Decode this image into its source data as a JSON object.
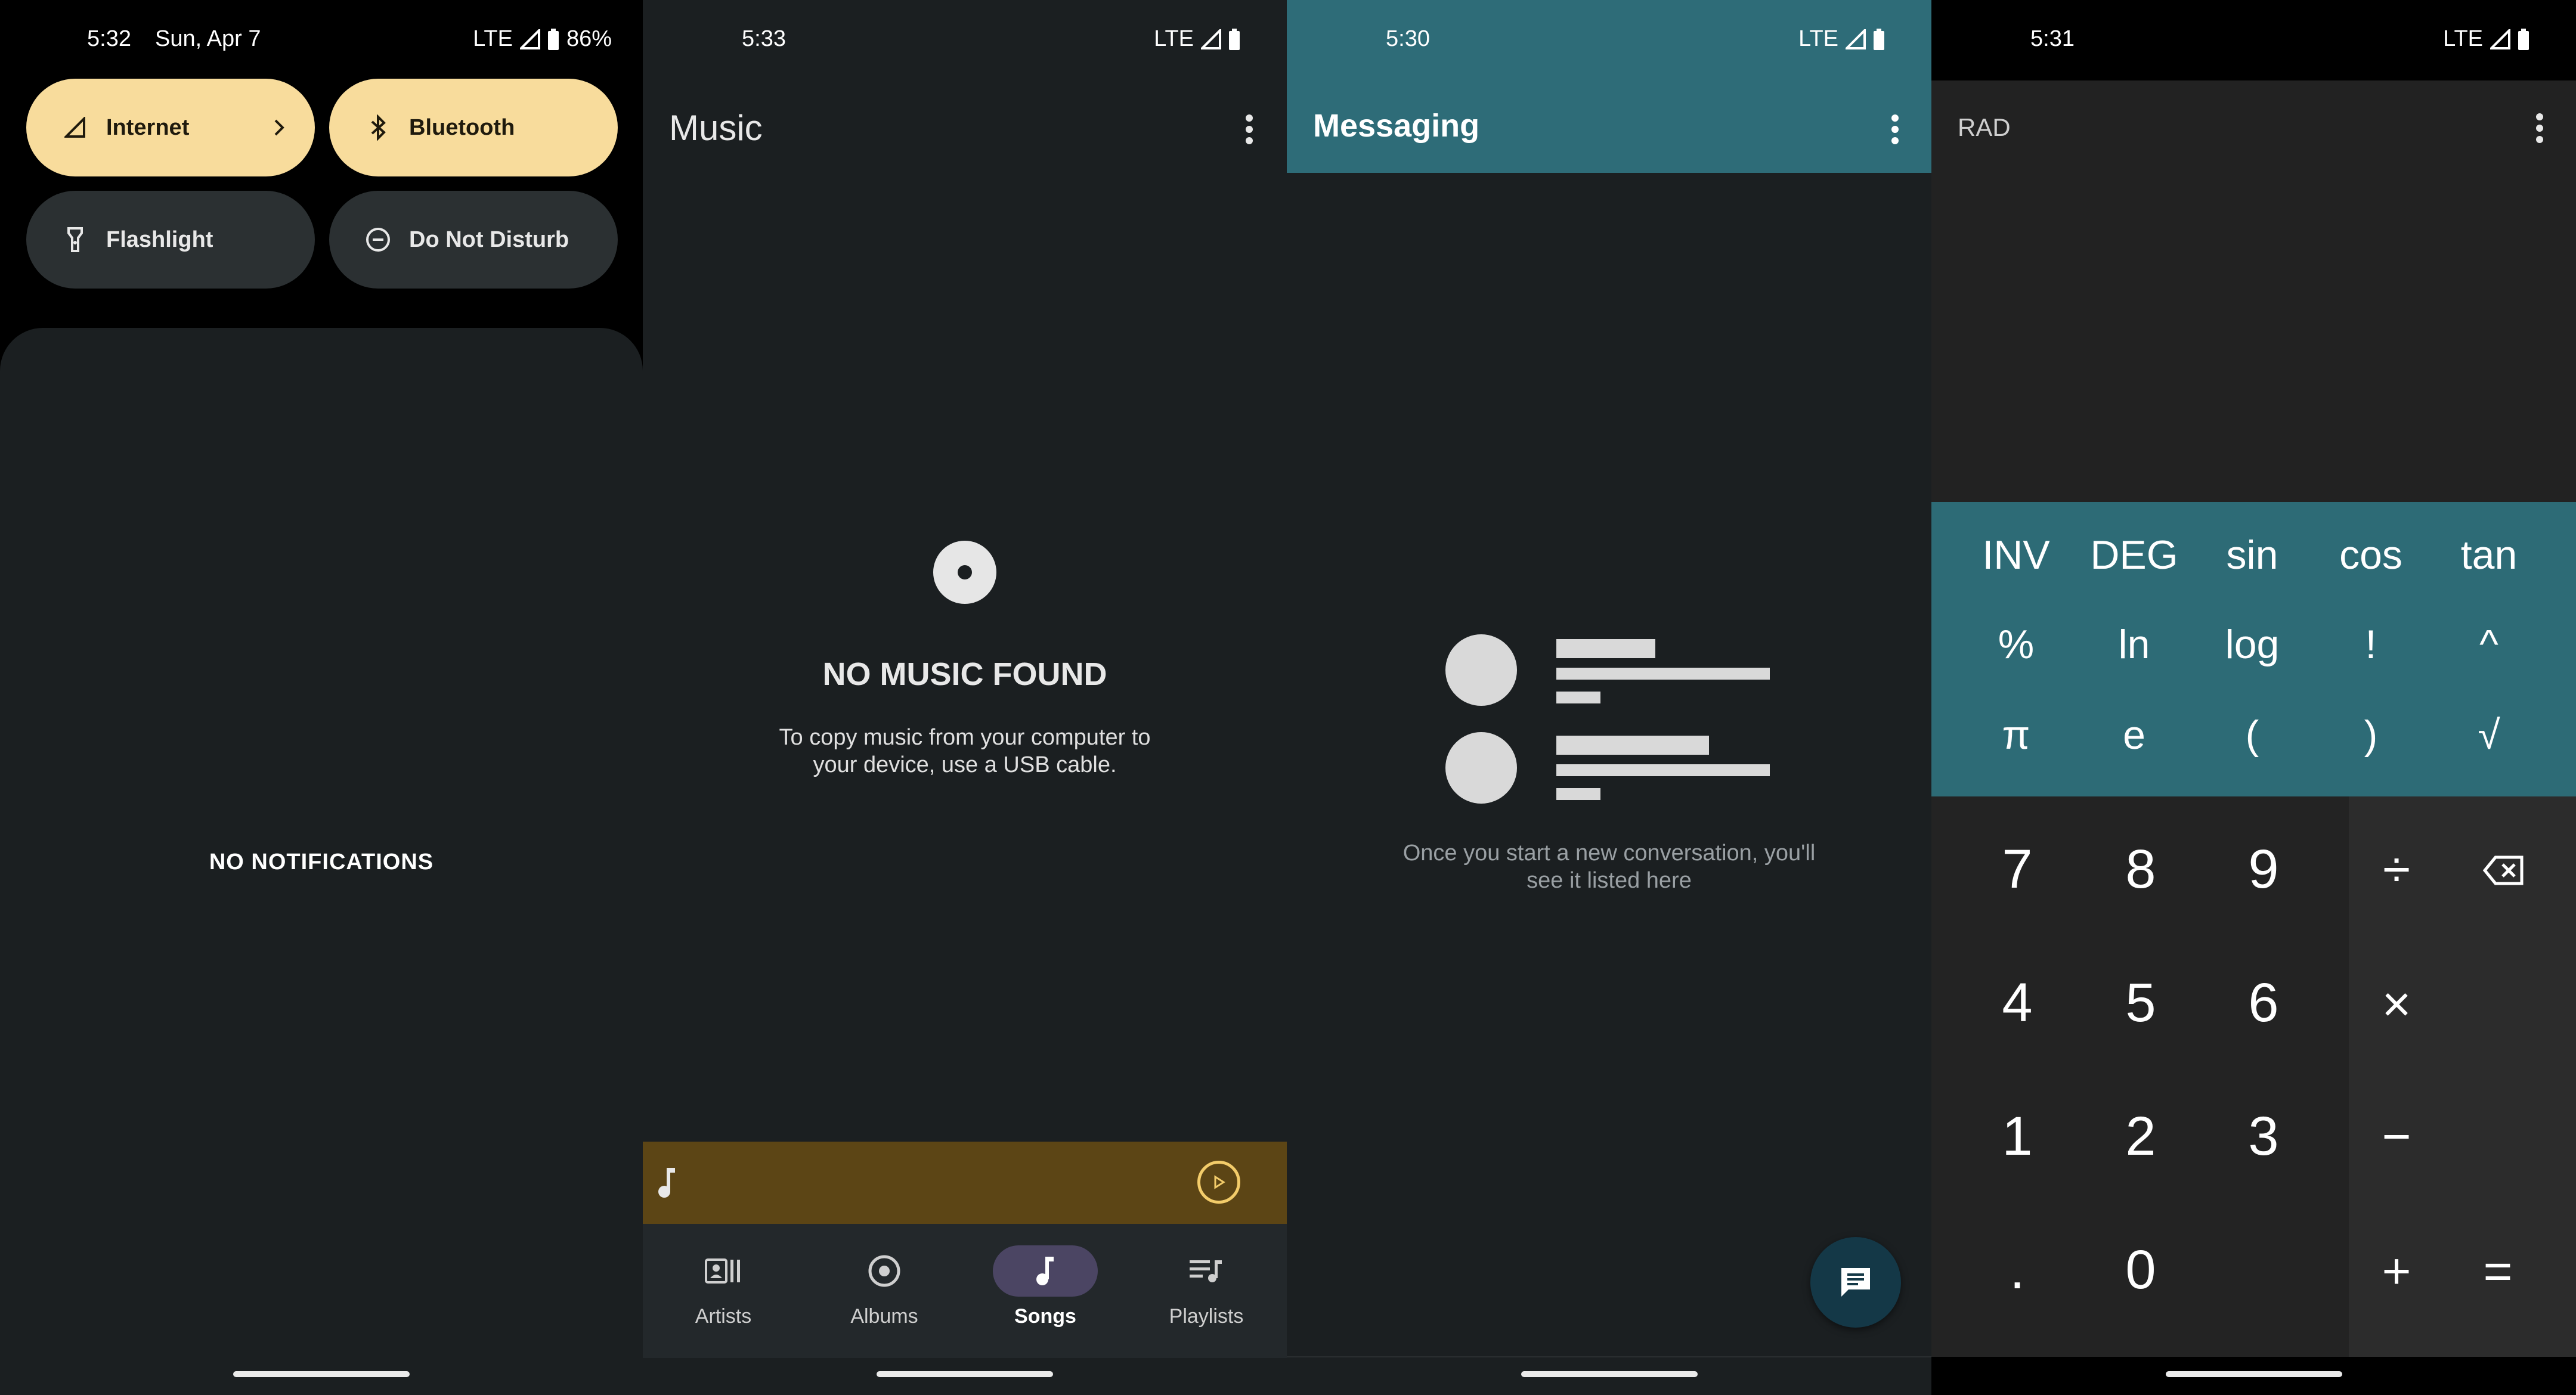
{
  "status_icons": {
    "network": "LTE",
    "signal": "signal-icon",
    "battery": "battery-icon"
  },
  "panel_notifications": {
    "status": {
      "time": "5:32",
      "date": "Sun, Apr 7",
      "network": "LTE",
      "battery": "86%"
    },
    "tiles": [
      {
        "label": "Internet",
        "icon": "signal-icon",
        "state": "on",
        "has_chevron": true
      },
      {
        "label": "Bluetooth",
        "icon": "bluetooth-icon",
        "state": "on"
      },
      {
        "label": "Flashlight",
        "icon": "flashlight-icon",
        "state": "off"
      },
      {
        "label": "Do Not Disturb",
        "icon": "do-not-disturb-icon",
        "state": "off"
      }
    ],
    "empty_text": "NO NOTIFICATIONS"
  },
  "panel_music": {
    "status": {
      "time": "5:33",
      "network": "LTE"
    },
    "title": "Music",
    "empty_title": "NO MUSIC FOUND",
    "empty_line1": "To copy music from your computer to",
    "empty_line2": "your device, use a USB cable.",
    "nav": [
      {
        "label": "Artists",
        "icon": "artists-icon",
        "active": false
      },
      {
        "label": "Albums",
        "icon": "album-icon",
        "active": false
      },
      {
        "label": "Songs",
        "icon": "music-note-icon",
        "active": true
      },
      {
        "label": "Playlists",
        "icon": "playlist-icon",
        "active": false
      }
    ],
    "colors": {
      "player_bar": "#5c4515",
      "active_pill": "#4b4563"
    }
  },
  "panel_messaging": {
    "status": {
      "time": "5:30",
      "network": "LTE"
    },
    "title": "Messaging",
    "empty_line1": "Once you start a new conversation, you'll",
    "empty_line2": "see it listed here",
    "colors": {
      "app_bar": "#2e6c78",
      "fab": "#143847"
    }
  },
  "panel_calculator": {
    "status": {
      "time": "5:31",
      "network": "LTE"
    },
    "mode": "RAD",
    "scientific": [
      [
        "INV",
        "DEG",
        "sin",
        "cos",
        "tan"
      ],
      [
        "%",
        "ln",
        "log",
        "!",
        "^"
      ],
      [
        "π",
        "e",
        "(",
        ")",
        "√"
      ]
    ],
    "digits": [
      [
        "7",
        "8",
        "9"
      ],
      [
        "4",
        "5",
        "6"
      ],
      [
        "1",
        "2",
        "3"
      ],
      [
        ".",
        "0",
        ""
      ]
    ],
    "operators": [
      [
        "÷",
        "backspace"
      ],
      [
        "×",
        ""
      ],
      [
        "−",
        ""
      ],
      [
        "+",
        "="
      ]
    ],
    "colors": {
      "scientific_panel": "#2d6b76"
    }
  }
}
